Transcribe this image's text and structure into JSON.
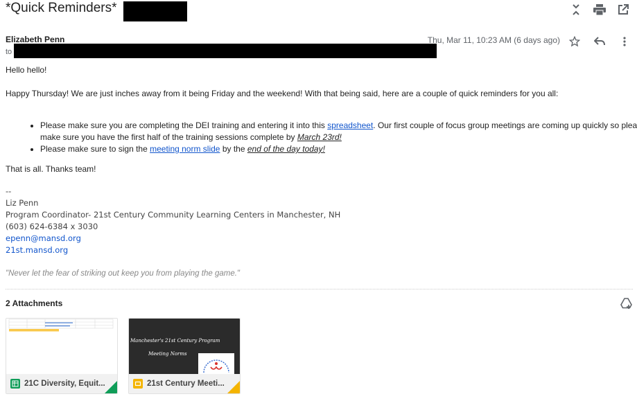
{
  "subject": "*Quick Reminders*",
  "header": {
    "sender": "Elizabeth Penn",
    "to_label": "to",
    "date": "Thu, Mar 11, 10:23 AM (6 days ago)"
  },
  "body": {
    "greeting": "Hello hello!",
    "intro": "Happy Thursday! We are just inches away from it being Friday and the weekend! With that being said, here are a couple of quick reminders for you all:",
    "bullet1_pre": "Please make sure you are completing the DEI training and entering it into this ",
    "bullet1_link": "spreadsheet",
    "bullet1_mid": ". Our first couple of focus group meetings are coming up quickly so please make sure you have the first half of the training sessions complete by ",
    "bullet1_em": "March 23rd!",
    "bullet2_pre": "Please make sure to sign the ",
    "bullet2_link": "meeting norm slide",
    "bullet2_mid": " by the ",
    "bullet2_em": "end of the day today!",
    "closing": "That is all. Thanks team!"
  },
  "signature": {
    "dashes": "--",
    "name": "Liz Penn",
    "title": "Program Coordinator- 21st Century Community Learning Centers in Manchester, NH",
    "phone": "(603) 624-6384 x 3030",
    "email": "epenn@mansd.org",
    "website": "21st.mansd.org",
    "quote": "\"Never let the fear of striking out keep you from playing the game.\""
  },
  "attachments": {
    "title": "2 Attachments",
    "items": [
      {
        "name": "21C Diversity, Equit...",
        "type": "sheets",
        "color": "#0f9d58"
      },
      {
        "name": "21st Century Meeti...",
        "type": "slides",
        "color": "#f4b400"
      }
    ],
    "slide_title": "Manchester's 21st Century Program",
    "slide_subtitle": "Meeting Norms"
  }
}
